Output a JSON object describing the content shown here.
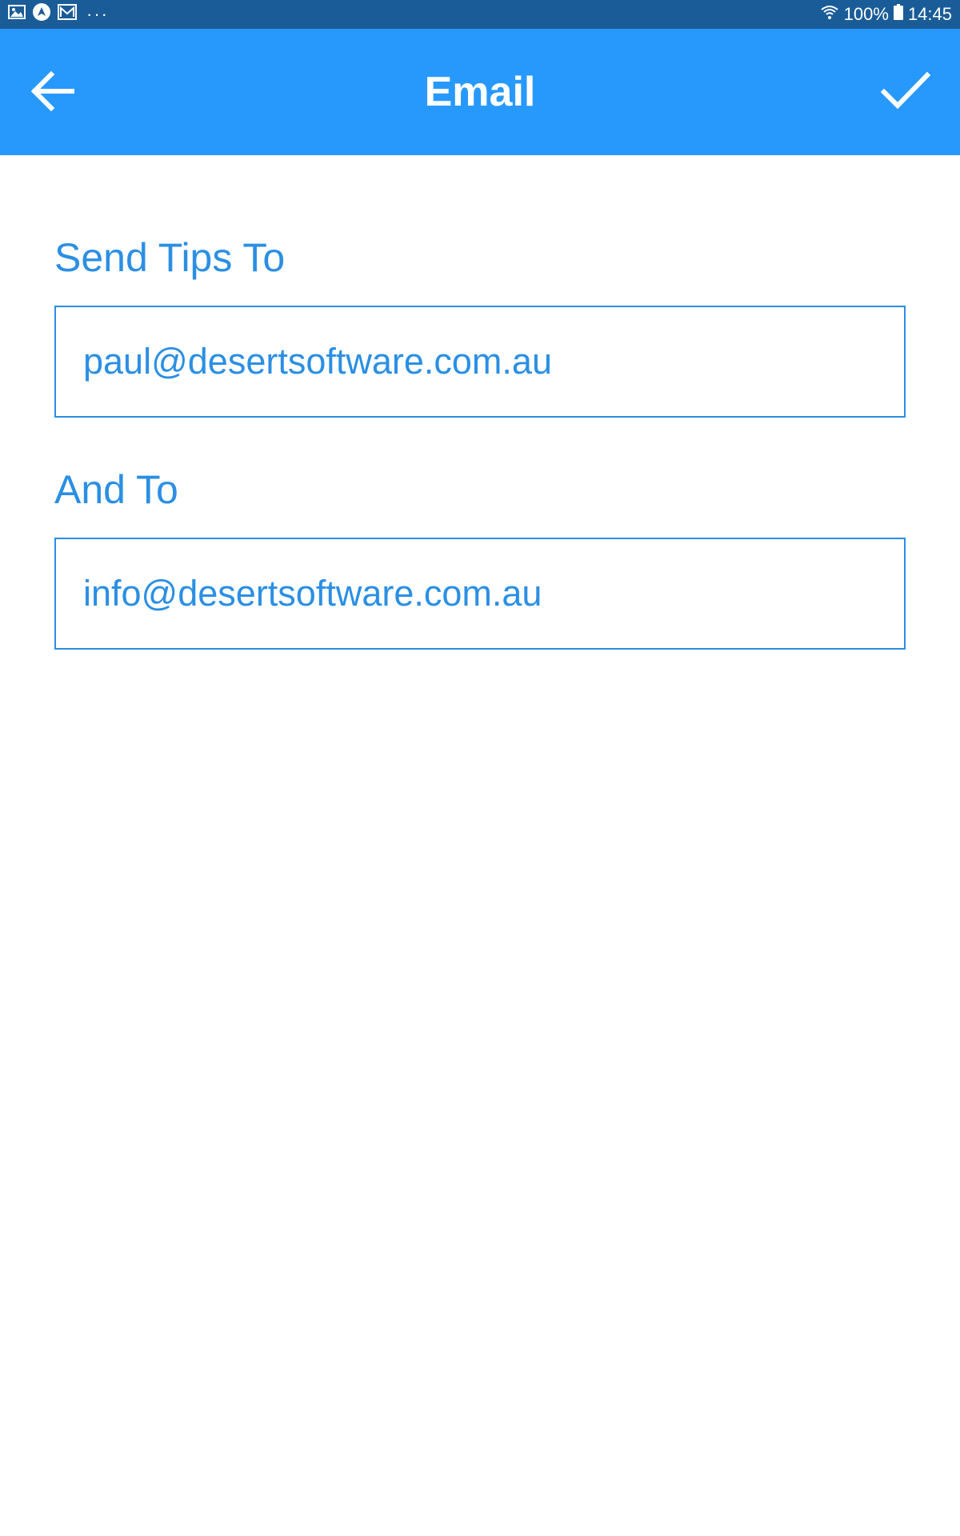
{
  "status_bar": {
    "left_icons": [
      "gallery-icon",
      "nav-icon",
      "email-icon",
      "more-icon"
    ],
    "overflow_dots": "···",
    "battery": "100%",
    "time": "14:45"
  },
  "app_bar": {
    "title": "Email",
    "back_icon": "arrow-left-icon",
    "done_icon": "check-icon"
  },
  "form": {
    "fields": [
      {
        "label": "Send Tips To",
        "value": "paul@desertsoftware.com.au"
      },
      {
        "label": "And To",
        "value": "info@desertsoftware.com.au"
      }
    ]
  },
  "colors": {
    "status_bar": "#1a5c98",
    "app_bar": "#2899fc",
    "accent": "#2b8fe3",
    "background": "#ffffff"
  }
}
